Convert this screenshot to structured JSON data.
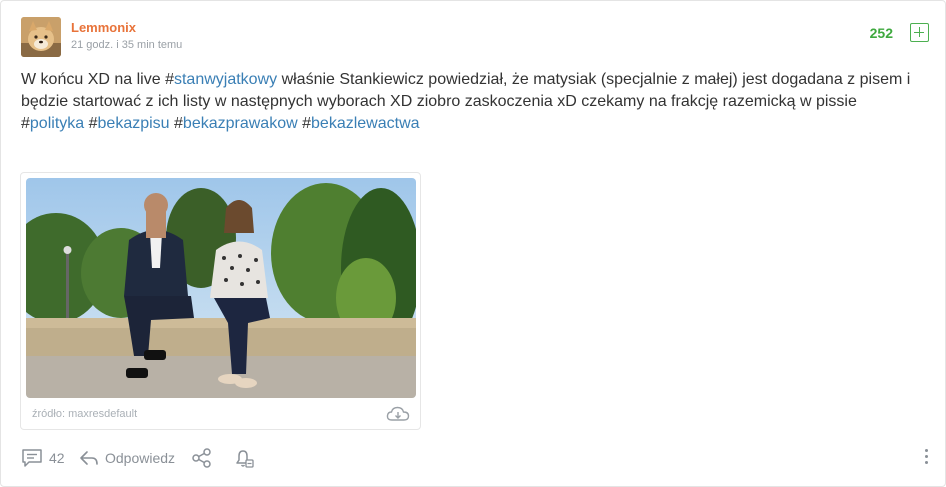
{
  "post": {
    "author": "Lemmonix",
    "time": "21 godz. i 35 min temu",
    "score": "252",
    "text_part1": "W końcu XD na live ",
    "inline_tag_hash": "#",
    "inline_tag": "stanwyjatkowy",
    "text_part2": " właśnie Stankiewicz powiedział, że matysiak (specjalnie z małej) jest dogadana z pisem i będzie startować z ich listy w następnych wyborach XD ziobro zaskoczenia xD czekamy na frakcję razemicką w pissie",
    "tags": [
      {
        "hash": "#",
        "label": "polityka"
      },
      {
        "hash": "#",
        "label": "bekazpisu"
      },
      {
        "hash": "#",
        "label": "bekazprawakow"
      },
      {
        "hash": "#",
        "label": "bekazlewactwa"
      }
    ]
  },
  "embed": {
    "source": "źródło: maxresdefault"
  },
  "actions": {
    "comments_count": "42",
    "reply_label": "Odpowiedz"
  },
  "icons": {
    "comments": "comment-icon",
    "reply": "reply-arrow-icon",
    "share": "share-icon",
    "notify": "bell-icon",
    "download": "cloud-download-icon",
    "more": "more-vertical-icon",
    "plus": "plus-icon"
  },
  "colors": {
    "author": "#e8733a",
    "score": "#3fa93f",
    "tag": "#3a7fb5",
    "muted": "#8a9097"
  }
}
